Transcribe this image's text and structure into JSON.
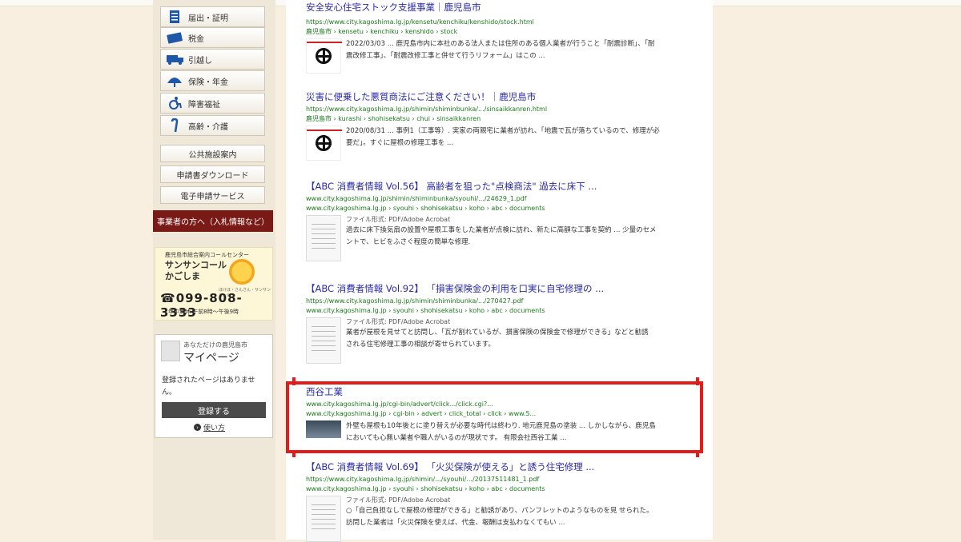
{
  "sidebar": {
    "nav_items": [
      {
        "label": "届出・証明",
        "icon": "document-icon"
      },
      {
        "label": "税金",
        "icon": "card-icon"
      },
      {
        "label": "引越し",
        "icon": "truck-icon"
      },
      {
        "label": "保険・年金",
        "icon": "umbrella-icon"
      },
      {
        "label": "障害福祉",
        "icon": "wheelchair-icon"
      },
      {
        "label": "高齢・介護",
        "icon": "cane-icon"
      }
    ],
    "plain_links": [
      "公共施設案内",
      "申請書ダウンロード",
      "電子申請サービス"
    ],
    "business_button": "事業者の方へ（入札情報など）",
    "call_center": {
      "header": "鹿児島市総合案内コールセンター",
      "title_line1": "サンサンコール",
      "title_line2": "かごしま",
      "small": "ほけほ・さんさん・サンサンコール",
      "phone": "099-808-3333",
      "hours": "年中無休 午前8時〜午後9時"
    },
    "mypage": {
      "header": "あなただけの鹿児島市",
      "title": "マイページ",
      "empty_text": "登録されたページはありません。",
      "register_button": "登録する",
      "help_link": "使い方"
    }
  },
  "results": [
    {
      "title": "安全安心住宅ストック支援事業｜鹿児島市",
      "url": "https://www.city.kagoshima.lg.jp/kensetu/kenchiku/kenshido/stock.html",
      "breadcrumb": "鹿児島市 › kensetu › kenchiku › kenshido › stock",
      "thumb": "kagoshima-emblem-icon",
      "file_type": "",
      "snippet_line1": "2022/03/03 ... 鹿児島市内に本社のある法人または住所のある個人業者が行うこと「耐震診断」、「耐",
      "snippet_line2": "震改修工事」、「耐震改修工事と併せて行うリフォーム」はこの ..."
    },
    {
      "title": "災害に便乗した悪質商法にご注意ください！｜鹿児島市",
      "url": "https://www.city.kagoshima.lg.jp/shimin/shiminbunka/.../sinsaikkanren.html",
      "breadcrumb": "鹿児島市 › kurashi › shohisekatsu › chui › sinsaikkanren",
      "thumb": "kagoshima-emblem-icon",
      "file_type": "",
      "snippet_line1": "2020/08/31 ... 事例1（工事等）. 実家の両親宅に業者が訪れ、「地震で瓦が落ちているので、修理が必",
      "snippet_line2": "要だ」。すぐに屋根の修理工事を ..."
    },
    {
      "title": "【ABC 消費者情報 Vol.56】 高齢者を狙った\"点検商法\" 過去に床下 ...",
      "url": "www.city.kagoshima.lg.jp/shimin/shiminbunka/syouhi/.../24629_1.pdf",
      "breadcrumb": "www.city.kagoshima.lg.jp › syouhi › shohisekatsu › koho › abc › documents",
      "thumb": "pdf-thumbnail",
      "file_type": "ファイル形式: PDF/Adobe Acrobat",
      "snippet_line1": "過去に床下換気扇の設置や屋根工事をした業者が点検に訪れ、新たに高額な工事を契約 ... 少量のセメ",
      "snippet_line2": "ントで、ヒビをふさぐ程度の簡単な修理."
    },
    {
      "title": "【ABC 消費者情報 Vol.92】 「損害保険金の利用を口実に自宅修理の ...",
      "url": "https://www.city.kagoshima.lg.jp/shimin/shiminbunka/.../270427.pdf",
      "breadcrumb": "www.city.kagoshima.lg.jp › syouhi › shohisekatsu › koho › abc › documents",
      "thumb": "pdf-thumbnail",
      "file_type": "ファイル形式: PDF/Adobe Acrobat",
      "snippet_line1": "業者が屋根を見せてと訪問し、「瓦が割れているが、損害保険の保険金で修理ができる」などと勧誘",
      "snippet_line2": "される住宅修理工事の相談が寄せられています。"
    },
    {
      "title": "西谷工業",
      "url": "www.city.kagoshima.lg.jp/cgi-bin/advert/click.../click.cgi?...",
      "breadcrumb": "www.city.kagoshima.lg.jp › cgi-bin › advert › click_total › click › www.5...",
      "thumb": "company-photo-thumbnail",
      "file_type": "",
      "snippet_line1": "外壁も屋根も10年後とに塗り替えが必要な時代は終わり. 地元鹿児島の塗装 ... しかしながら、鹿児島",
      "snippet_line2": "においても心無い業者や職人がいるのが現状です。 有限会社西谷工業 ..."
    },
    {
      "title": "【ABC 消費者情報 Vol.69】 「火災保険が使える」と誘う住宅修理 ...",
      "url": "https://www.city.kagoshima.lg.jp/shimin/.../syouhi/.../20137511481_1.pdf",
      "breadcrumb": "www.city.kagoshima.lg.jp › syouhi › shohisekatsu › koho › abc › documents",
      "thumb": "pdf-thumbnail",
      "file_type": "ファイル形式: PDF/Adobe Acrobat",
      "snippet_line1": "○「自己負担なしで屋根の修理ができる」と勧誘があり、パンフレットのようなものを見 せられた。",
      "snippet_line2": "訪問した業者は「火災保険を使えば、代金、報酬は支払わなくてもい ..."
    }
  ],
  "colors": {
    "highlight": "#e21b1b",
    "link": "#2a2aa8",
    "url": "#1a7a1a",
    "business_button": "#7a1a16"
  }
}
